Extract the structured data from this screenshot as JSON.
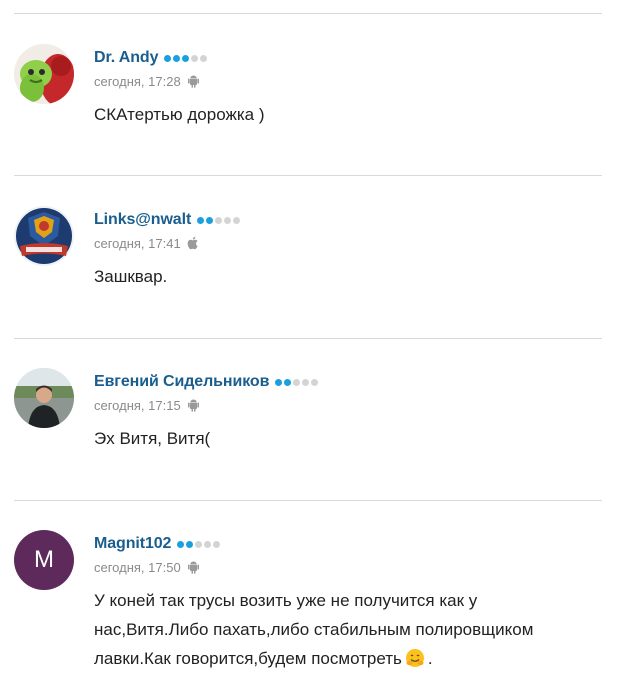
{
  "comments": [
    {
      "author": "Dr. Andy",
      "rating": 3,
      "time": "сегодня, 17:28",
      "os_icon": "android-icon",
      "text": "СКАтертью дорожка )",
      "avatar": "green-red-figures-avatar"
    },
    {
      "author": "Links@nwalt",
      "rating": 2,
      "time": "сегодня, 17:41",
      "os_icon": "apple-icon",
      "text": "Зашквар.",
      "avatar": "metallurg-logo-avatar"
    },
    {
      "author": "Евгений Сидельников",
      "rating": 2,
      "time": "сегодня, 17:15",
      "os_icon": "android-icon",
      "text": "Эх Витя, Витя(",
      "avatar": "man-photo-avatar"
    },
    {
      "author": "Magnit102",
      "rating": 2,
      "time": "сегодня, 17:50",
      "os_icon": "android-icon",
      "avatar_letter": "M",
      "text_line1": "У коней так трусы возить уже не получится как у",
      "text_line2": "нас,Витя.Либо пахать,либо стабильным полировщиком",
      "text_line3": "лавки.Как говорится,будем посмотреть",
      "text_end": ".",
      "emoji": "hugging-face-emoji"
    }
  ],
  "colors": {
    "author": "#1a5e8f",
    "rating_on": "#1aa0e0",
    "rating_off": "#d4d4d4",
    "meta": "#8a8a8a",
    "divider": "#d9d9d9",
    "avatar_letter_bg": "#5e2a5c"
  }
}
